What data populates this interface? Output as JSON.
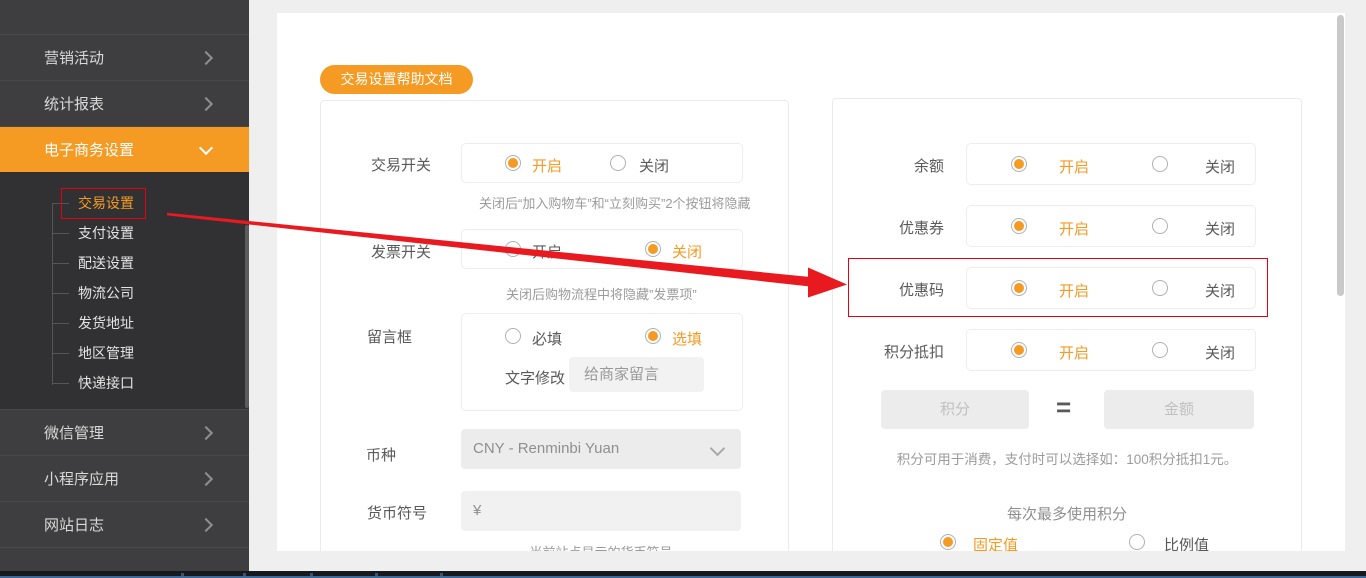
{
  "colors": {
    "orange": "#f59a23",
    "annotation_red": "#e60012",
    "sidebar_bg": "#3e3e40"
  },
  "sidebar": {
    "items": [
      {
        "label": "营销活动"
      },
      {
        "label": "统计报表"
      },
      {
        "label": "电子商务设置"
      },
      {
        "label": "微信管理"
      },
      {
        "label": "小程序应用"
      },
      {
        "label": "网站日志"
      }
    ],
    "submenu": {
      "items": [
        {
          "label": "交易设置"
        },
        {
          "label": "支付设置"
        },
        {
          "label": "配送设置"
        },
        {
          "label": "物流公司"
        },
        {
          "label": "发货地址"
        },
        {
          "label": "地区管理"
        },
        {
          "label": "快递接口"
        }
      ],
      "selected": "交易设置"
    }
  },
  "header": {
    "help_button": "交易设置帮助文档"
  },
  "trade": {
    "switch": {
      "label": "交易开关",
      "on": "开启",
      "off": "关闭",
      "selected": "on",
      "helper": "关闭后“加入购物车”和“立刻购买”2个按钮将隐藏"
    },
    "invoice": {
      "label": "发票开关",
      "on": "开启",
      "off": "关闭",
      "selected": "off",
      "helper": "关闭后购物流程中将隐藏”发票项”"
    },
    "message": {
      "label": "留言框",
      "required": "必填",
      "optional": "选填",
      "selected": "optional",
      "edit_label": "文字修改",
      "edit_value": "给商家留言"
    },
    "currency": {
      "label": "币种",
      "value": "CNY - Renminbi Yuan"
    },
    "symbol": {
      "label": "货币符号",
      "value": "¥",
      "helper": "当前站点显示的货币符号"
    }
  },
  "promo": {
    "balance": {
      "label": "余额",
      "on": "开启",
      "off": "关闭",
      "selected": "on"
    },
    "coupon": {
      "label": "优惠券",
      "on": "开启",
      "off": "关闭",
      "selected": "on"
    },
    "code": {
      "label": "优惠码",
      "on": "开启",
      "off": "关闭",
      "selected": "on",
      "highlighted": true
    },
    "points": {
      "label": "积分抵扣",
      "on": "开启",
      "off": "关闭",
      "selected": "on"
    },
    "points_input": {
      "placeholder": "积分"
    },
    "equals": "=",
    "amount_input": {
      "placeholder": "金额"
    },
    "helper": "积分可用于消费，支付时可以选择如：100积分抵扣1元。",
    "max_label": "每次最多使用积分",
    "fixed": "固定值",
    "ratio": "比例值",
    "value_type_selected": "fixed"
  }
}
